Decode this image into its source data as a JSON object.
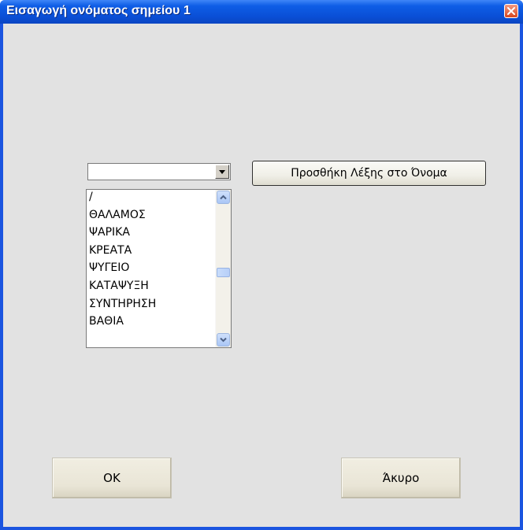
{
  "window": {
    "title": "Εισαγωγή ονόματος σημείου 1"
  },
  "combo": {
    "value": ""
  },
  "list": {
    "items": [
      "/",
      "ΘΑΛΑΜΟΣ",
      "ΨΑΡΙΚΑ",
      "ΚΡΕΑΤΑ",
      "ΨΥΓΕΙΟ",
      "ΚΑΤΑΨΥΞΗ",
      "ΣΥΝΤΗΡΗΣΗ",
      "ΒΑΘΙΑ"
    ]
  },
  "buttons": {
    "add_word": "Προσθήκη Λέξης στο Όνομα",
    "ok": "OK",
    "cancel": "Άκυρο"
  },
  "icons": {
    "close": "close-icon",
    "dropdown": "chevron-down-icon",
    "scroll_up": "chevron-up-icon",
    "scroll_down": "chevron-down-icon"
  },
  "colors": {
    "titlebar": "#0a4fd6",
    "window_bg": "#e2e2e2",
    "close": "#d8471f"
  }
}
